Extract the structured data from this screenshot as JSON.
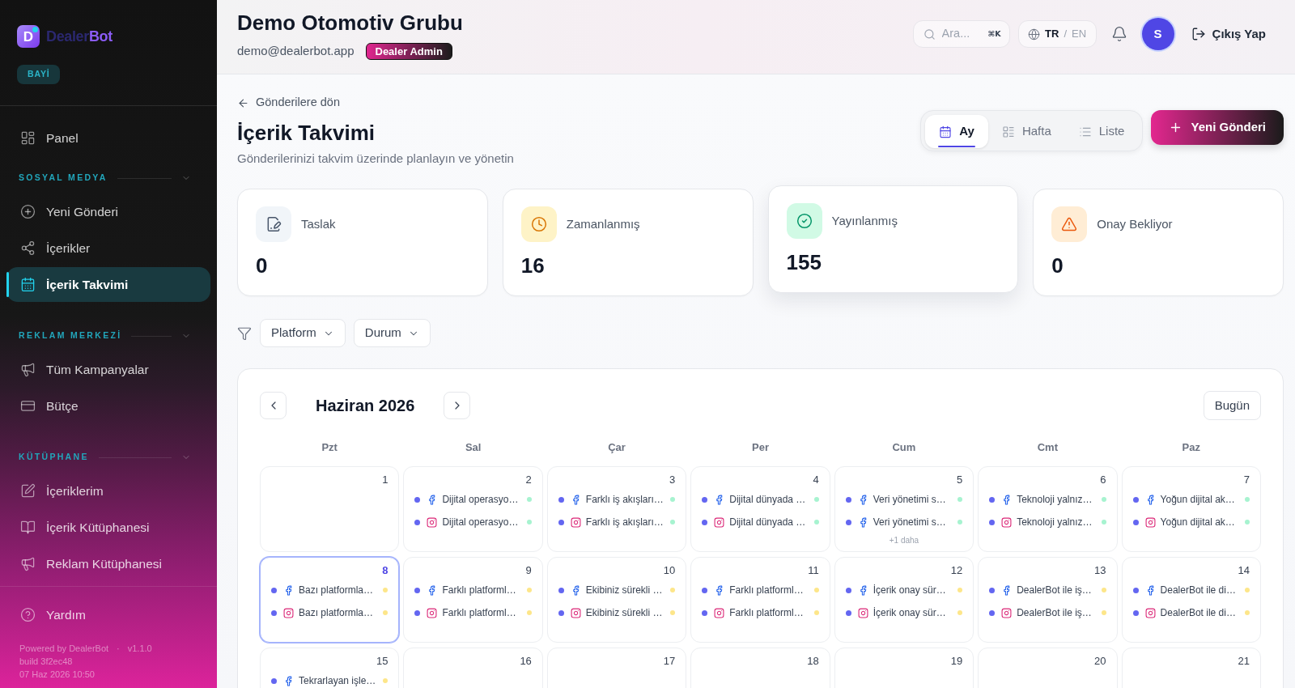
{
  "sidebar": {
    "brand": {
      "mark": "D",
      "name_start": "Dealer",
      "name_end": "Bot"
    },
    "role_badge": "BAYİ",
    "top_items": [
      {
        "label": "Panel",
        "selected": false
      }
    ],
    "sections": [
      {
        "title": "SOSYAL MEDYA",
        "expanded": true,
        "items": [
          {
            "label": "Yeni Gönderi",
            "selected": false
          },
          {
            "label": "İçerikler",
            "selected": false
          },
          {
            "label": "İçerik Takvimi",
            "selected": true
          }
        ]
      },
      {
        "title": "REKLAM MERKEZİ",
        "expanded": true,
        "items": [
          {
            "label": "Tüm Kampanyalar",
            "selected": false
          },
          {
            "label": "Bütçe",
            "selected": false
          }
        ]
      },
      {
        "title": "KÜTÜPHANE",
        "expanded": true,
        "items": [
          {
            "label": "İçeriklerim",
            "selected": false
          },
          {
            "label": "İçerik Kütüphanesi",
            "selected": false
          },
          {
            "label": "Reklam Kütüphanesi",
            "selected": false
          }
        ]
      }
    ],
    "help": {
      "label": "Yardım",
      "selected": false
    },
    "footer": {
      "powered_by": "Powered by DealerBot",
      "separator": "·",
      "version": "v1.1.0",
      "build": "build 3f2ec48",
      "timestamp": "07 Haz 2026 10:50"
    }
  },
  "header": {
    "title": "Demo Otomotiv Grubu",
    "email": "demo@dealerbot.app",
    "role": "Dealer Admin",
    "search": {
      "placeholder": "Ara...",
      "shortcut": "⌘K"
    },
    "languages": [
      {
        "label": "TR",
        "selected": true
      },
      {
        "label": "EN",
        "selected": false
      }
    ],
    "language_separator": "/",
    "avatar": "S",
    "logout": "Çıkış Yap"
  },
  "page": {
    "back_link": "Gönderilere dön",
    "title": "İçerik Takvimi",
    "subtitle": "Gönderilerinizi takvim üzerinde planlayın ve yönetin",
    "view_tabs": [
      {
        "label": "Ay",
        "selected": true
      },
      {
        "label": "Hafta",
        "selected": false
      },
      {
        "label": "Liste",
        "selected": false
      }
    ],
    "new_post_button": "Yeni Gönderi"
  },
  "stats": [
    {
      "label": "Taslak",
      "value": "0",
      "raised": false
    },
    {
      "label": "Zamanlanmış",
      "value": "16",
      "raised": false
    },
    {
      "label": "Yayınlanmış",
      "value": "155",
      "raised": true
    },
    {
      "label": "Onay Bekliyor",
      "value": "0",
      "raised": false
    }
  ],
  "filters": [
    {
      "label": "Platform"
    },
    {
      "label": "Durum"
    }
  ],
  "calendar": {
    "month": "Haziran 2026",
    "today_button": "Bugün",
    "weekdays": [
      "Pzt",
      "Sal",
      "Çar",
      "Per",
      "Cum",
      "Cmt",
      "Paz"
    ],
    "weeks": [
      {
        "days": [
          {
            "day": "1",
            "selected": false
          },
          {
            "day": "2",
            "selected": false,
            "events": [
              {
                "kind": "facebook",
                "title": "Dijital operasyo…",
                "color": "#a7f3d0"
              },
              {
                "kind": "instagram",
                "title": "Dijital operasyo…",
                "color": "#a7f3d0"
              }
            ]
          },
          {
            "day": "3",
            "selected": false,
            "events": [
              {
                "kind": "facebook",
                "title": "Farklı iş akışları…",
                "color": "#a7f3d0"
              },
              {
                "kind": "instagram",
                "title": "Farklı iş akışları…",
                "color": "#a7f3d0"
              }
            ]
          },
          {
            "day": "4",
            "selected": false,
            "events": [
              {
                "kind": "facebook",
                "title": "Dijital dünyada …",
                "color": "#a7f3d0"
              },
              {
                "kind": "instagram",
                "title": "Dijital dünyada …",
                "color": "#a7f3d0"
              }
            ]
          },
          {
            "day": "5",
            "selected": false,
            "events": [
              {
                "kind": "facebook",
                "title": "Veri yönetimi s…",
                "color": "#a7f3d0"
              },
              {
                "kind": "facebook",
                "title": "Veri yönetimi s…",
                "color": "#a7f3d0"
              }
            ],
            "more": "+1 daha"
          },
          {
            "day": "6",
            "selected": false,
            "events": [
              {
                "kind": "facebook",
                "title": "Teknoloji yalnız…",
                "color": "#a7f3d0"
              },
              {
                "kind": "instagram",
                "title": "Teknoloji yalnız…",
                "color": "#a7f3d0"
              }
            ]
          },
          {
            "day": "7",
            "selected": false,
            "events": [
              {
                "kind": "facebook",
                "title": "Yoğun dijital ak…",
                "color": "#a7f3d0"
              },
              {
                "kind": "instagram",
                "title": "Yoğun dijital ak…",
                "color": "#a7f3d0"
              }
            ]
          }
        ]
      },
      {
        "days": [
          {
            "day": "8",
            "selected": true,
            "events": [
              {
                "kind": "facebook",
                "title": "Bazı platformla…",
                "color": "#fde68a"
              },
              {
                "kind": "instagram",
                "title": "Bazı platformla…",
                "color": "#fde68a"
              }
            ]
          },
          {
            "day": "9",
            "selected": false,
            "events": [
              {
                "kind": "facebook",
                "title": "Farklı platforml…",
                "color": "#fde68a"
              },
              {
                "kind": "instagram",
                "title": "Farklı platforml…",
                "color": "#fde68a"
              }
            ]
          },
          {
            "day": "10",
            "selected": false,
            "events": [
              {
                "kind": "facebook",
                "title": "Ekibiniz sürekli …",
                "color": "#fde68a"
              },
              {
                "kind": "instagram",
                "title": "Ekibiniz sürekli …",
                "color": "#fde68a"
              }
            ]
          },
          {
            "day": "11",
            "selected": false,
            "events": [
              {
                "kind": "facebook",
                "title": "Farklı platforml…",
                "color": "#fde68a"
              },
              {
                "kind": "instagram",
                "title": "Farklı platforml…",
                "color": "#fde68a"
              }
            ]
          },
          {
            "day": "12",
            "selected": false,
            "events": [
              {
                "kind": "facebook",
                "title": "İçerik onay sür…",
                "color": "#fde68a"
              },
              {
                "kind": "instagram",
                "title": "İçerik onay sür…",
                "color": "#fde68a"
              }
            ]
          },
          {
            "day": "13",
            "selected": false,
            "events": [
              {
                "kind": "facebook",
                "title": "DealerBot ile iş…",
                "color": "#fde68a"
              },
              {
                "kind": "instagram",
                "title": "DealerBot ile iş…",
                "color": "#fde68a"
              }
            ]
          },
          {
            "day": "14",
            "selected": false,
            "events": [
              {
                "kind": "facebook",
                "title": "DealerBot ile di…",
                "color": "#fde68a"
              },
              {
                "kind": "instagram",
                "title": "DealerBot ile di…",
                "color": "#fde68a"
              }
            ]
          }
        ]
      },
      {
        "days": [
          {
            "day": "15",
            "selected": false,
            "events": [
              {
                "kind": "facebook",
                "title": "Tekrarlayan işle…",
                "color": "#fde68a"
              }
            ]
          },
          {
            "day": "16",
            "selected": false
          },
          {
            "day": "17",
            "selected": false
          },
          {
            "day": "18",
            "selected": false
          },
          {
            "day": "19",
            "selected": false
          },
          {
            "day": "20",
            "selected": false
          },
          {
            "day": "21",
            "selected": false
          }
        ]
      }
    ]
  }
}
